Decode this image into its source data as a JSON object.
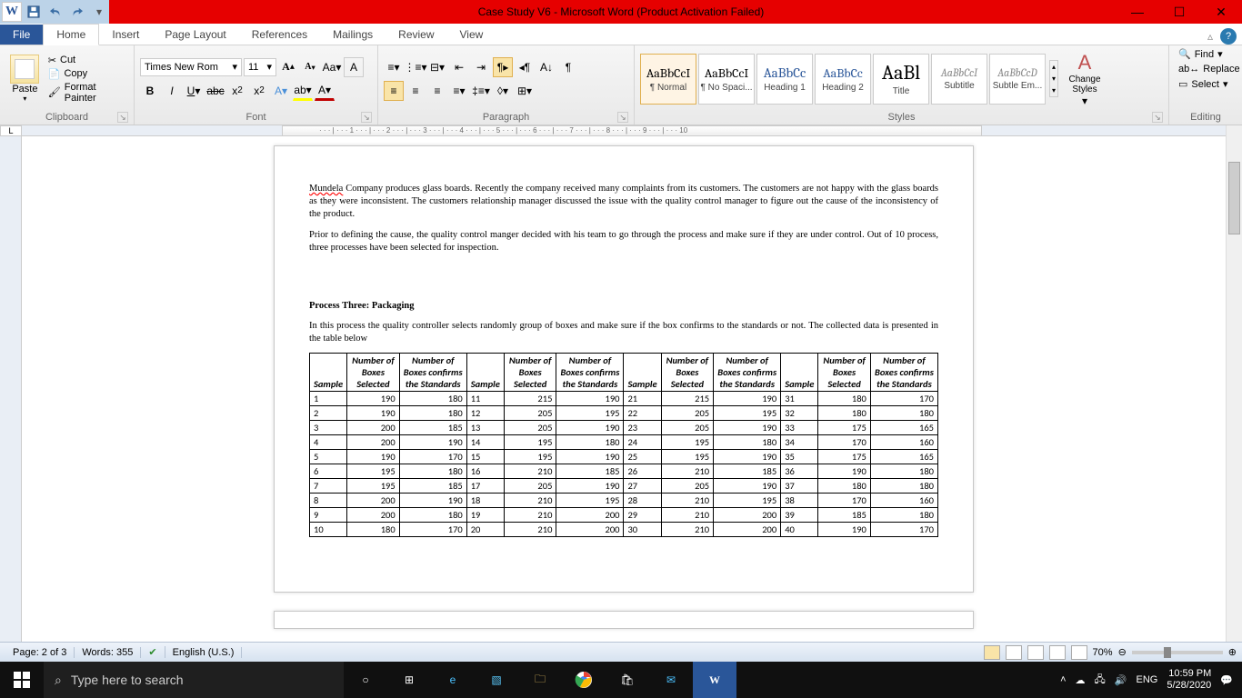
{
  "title": "Case Study V6 - Microsoft Word (Product Activation Failed)",
  "tabs": [
    "File",
    "Home",
    "Insert",
    "Page Layout",
    "References",
    "Mailings",
    "Review",
    "View"
  ],
  "clipboard": {
    "label": "Clipboard",
    "paste": "Paste",
    "cut": "Cut",
    "copy": "Copy",
    "fmt": "Format Painter"
  },
  "font": {
    "label": "Font",
    "name": "Times New Rom",
    "size": "11"
  },
  "paragraph": {
    "label": "Paragraph"
  },
  "styles": {
    "label": "Styles",
    "change": "Change Styles",
    "items": [
      {
        "prev": "AaBbCcI",
        "name": "¶ Normal"
      },
      {
        "prev": "AaBbCcI",
        "name": "¶ No Spaci..."
      },
      {
        "prev": "AaBbCc",
        "name": "Heading 1"
      },
      {
        "prev": "AaBbCc",
        "name": "Heading 2"
      },
      {
        "prev": "AaBl",
        "name": "Title"
      },
      {
        "prev": "AaBbCcI",
        "name": "Subtitle"
      },
      {
        "prev": "AaBbCcD",
        "name": "Subtle Em..."
      }
    ]
  },
  "editing": {
    "label": "Editing",
    "find": "Find",
    "replace": "Replace",
    "select": "Select"
  },
  "doc": {
    "p1a": "Mundela",
    "p1b": " Company produces glass boards. Recently the company received many complaints from its customers. The customers are not happy with the glass boards as they were inconsistent. The customers relationship manager discussed the issue with the quality control manager to figure out the cause of the inconsistency of the product.",
    "p2": "Prior to defining the cause, the quality control manger decided with his team to go through the process and make sure if they are under control. Out of 10 process, three processes have been selected for inspection.",
    "h3": "Process Three: Packaging",
    "p3": "In this process the quality controller selects randomly group of boxes and make sure if the box confirms to the standards or not. The collected data is presented in the table below",
    "headers": [
      "Sample",
      "Number of Boxes Selected",
      "Number of Boxes confirms the Standards",
      "Sample",
      "Number of Boxes Selected",
      "Number of Boxes confirms the Standards",
      "Sample",
      "Number of Boxes Selected",
      "Number of Boxes confirms the Standards",
      "Sample",
      "Number of Boxes Selected",
      "Number of Boxes confirms the Standards"
    ],
    "rows": [
      [
        "1",
        "190",
        "180",
        "11",
        "215",
        "190",
        "21",
        "215",
        "190",
        "31",
        "180",
        "170"
      ],
      [
        "2",
        "190",
        "180",
        "12",
        "205",
        "195",
        "22",
        "205",
        "195",
        "32",
        "180",
        "180"
      ],
      [
        "3",
        "200",
        "185",
        "13",
        "205",
        "190",
        "23",
        "205",
        "190",
        "33",
        "175",
        "165"
      ],
      [
        "4",
        "200",
        "190",
        "14",
        "195",
        "180",
        "24",
        "195",
        "180",
        "34",
        "170",
        "160"
      ],
      [
        "5",
        "190",
        "170",
        "15",
        "195",
        "190",
        "25",
        "195",
        "190",
        "35",
        "175",
        "165"
      ],
      [
        "6",
        "195",
        "180",
        "16",
        "210",
        "185",
        "26",
        "210",
        "185",
        "36",
        "190",
        "180"
      ],
      [
        "7",
        "195",
        "185",
        "17",
        "205",
        "190",
        "27",
        "205",
        "190",
        "37",
        "180",
        "180"
      ],
      [
        "8",
        "200",
        "190",
        "18",
        "210",
        "195",
        "28",
        "210",
        "195",
        "38",
        "170",
        "160"
      ],
      [
        "9",
        "200",
        "180",
        "19",
        "210",
        "200",
        "29",
        "210",
        "200",
        "39",
        "185",
        "180"
      ],
      [
        "10",
        "180",
        "170",
        "20",
        "210",
        "200",
        "30",
        "210",
        "200",
        "40",
        "190",
        "170"
      ]
    ]
  },
  "status": {
    "page": "Page: 2 of 3",
    "words": "Words: 355",
    "lang": "English (U.S.)",
    "zoom": "70%"
  },
  "taskbar": {
    "search": "Type here to search",
    "lang": "ENG",
    "time": "10:59 PM",
    "date": "5/28/2020"
  },
  "ruler_marks": "· · · | · · · 1 · · · | · · · 2 · · · | · · · 3 · · · | · · · 4 · · · | · · · 5 · · · | · · · 6 · · · | · · · 7 · · · | · · · 8 · · · | · · · 9 · · · | · · · 10"
}
